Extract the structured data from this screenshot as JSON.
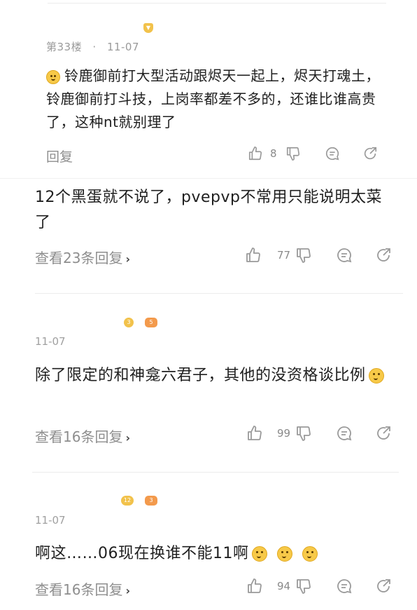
{
  "comments": [
    {
      "floor": "第33楼",
      "dot": "·",
      "date": "11-07",
      "text": "铃鹿御前打大型活动跟烬天一起上，烬天打魂土，铃鹿御前打斗技，上岗率都差不多的，还谁比谁高贵了，这种nt就别理了",
      "reply_label": "回复",
      "like_count": "8",
      "emoji_icon": "thinking-face-icon"
    },
    {
      "text": "12个黑蛋就不说了，pvepvp不常用只能说明太菜了",
      "reply_label": "查看23条回复",
      "chevron": "›",
      "like_count": "77"
    },
    {
      "date": "11-07",
      "text": "除了限定的和神龛六君子，其他的没资格谈比例",
      "reply_label": "查看16条回复",
      "chevron": "›",
      "like_count": "99",
      "badges": [
        "3",
        "5"
      ],
      "emoji_icon": "smile-face-icon"
    },
    {
      "date": "11-07",
      "text": "啊这……06现在换谁不能11啊",
      "reply_label": "查看16条回复",
      "chevron": "›",
      "like_count": "94",
      "badges": [
        "12",
        "3"
      ],
      "emoji_icons": [
        "grimace-face-icon",
        "grimace-face-icon",
        "grimace-face-icon"
      ]
    }
  ],
  "colors": {
    "badge_gold": "#f2c24b",
    "badge_orange": "#f39a4c",
    "text_gray": "#8e8e8e",
    "emoji_yellow": "#f7c948"
  }
}
